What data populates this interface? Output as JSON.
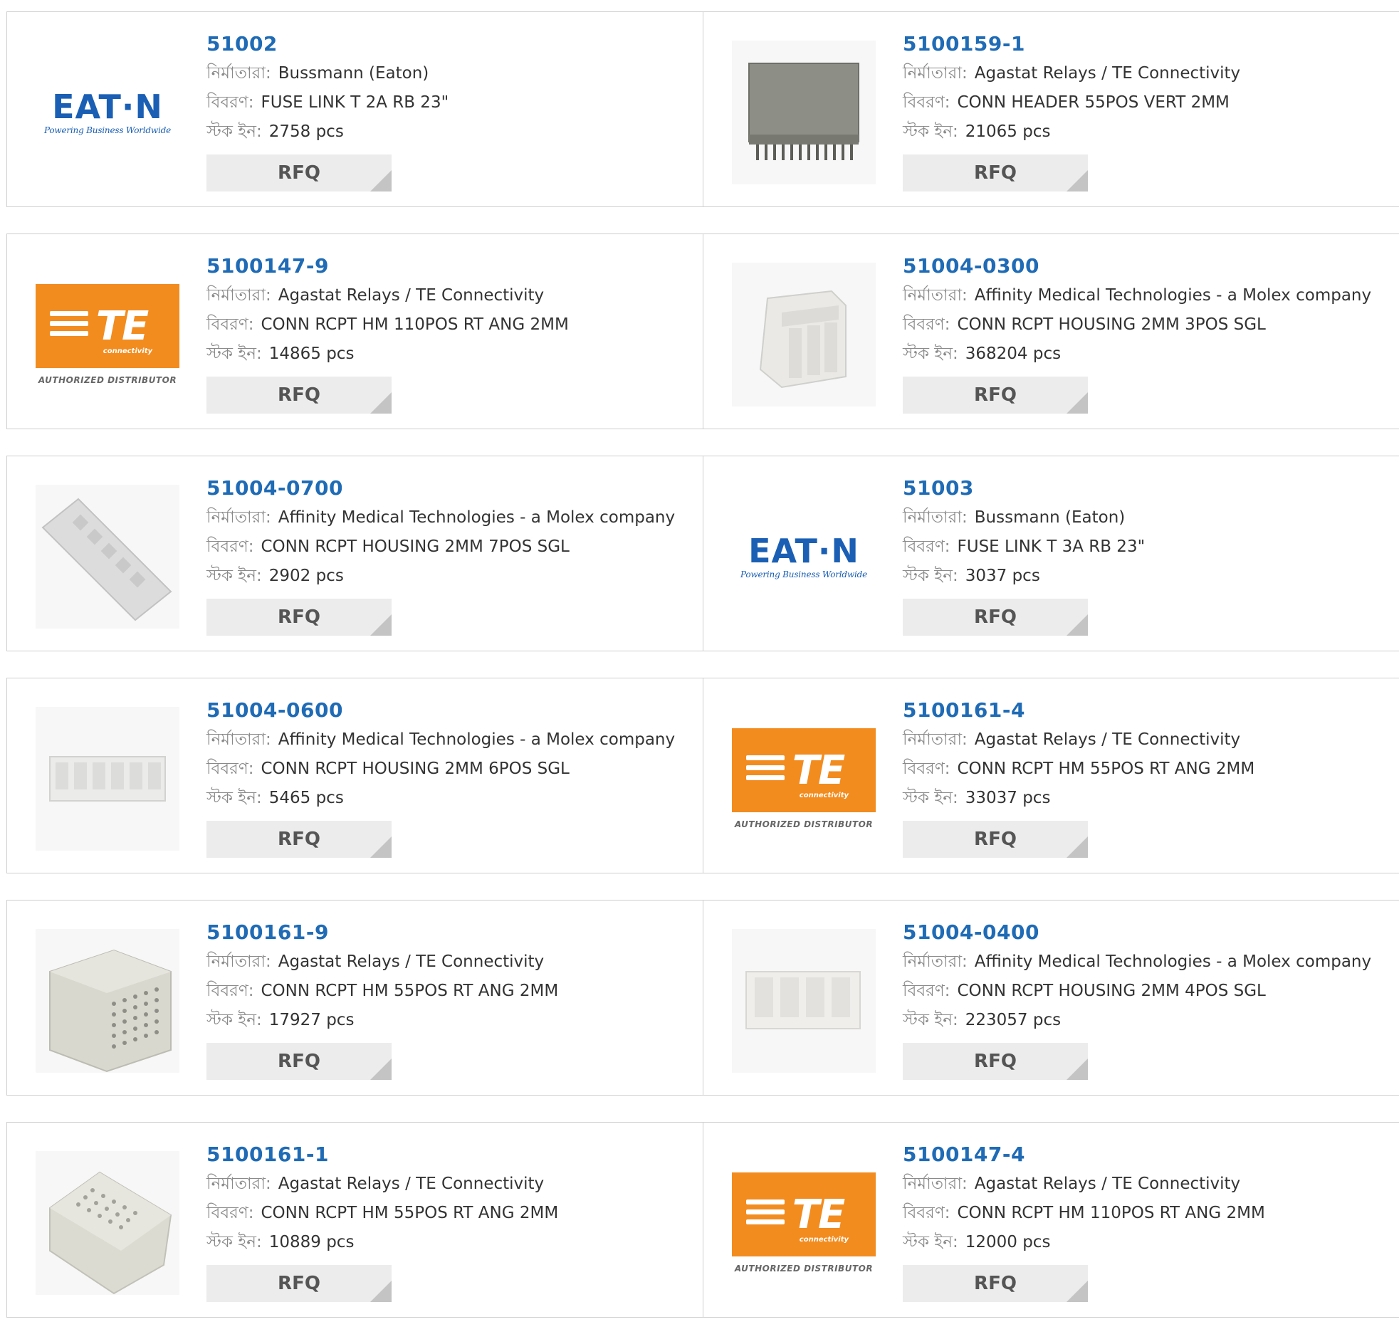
{
  "labels": {
    "manufacturer": "নির্মাতারা:",
    "description": "বিবরণ:",
    "stock": "স্টক ইন:",
    "rfq": "RFQ"
  },
  "logos": {
    "eaton_word": "EAT·N",
    "eaton_tag": "Powering Business Worldwide",
    "te_word": "TE",
    "te_sub": "connectivity",
    "te_dist": "AUTHORIZED DISTRIBUTOR"
  },
  "products": [
    {
      "part": "51002",
      "manufacturer": "Bussmann (Eaton)",
      "description": "FUSE LINK T 2A RB 23\"",
      "stock": "2758 pcs",
      "image": "eaton-logo"
    },
    {
      "part": "5100159-1",
      "manufacturer": "Agastat Relays / TE Connectivity",
      "description": "CONN HEADER 55POS VERT 2MM",
      "stock": "21065 pcs",
      "image": "header-photo"
    },
    {
      "part": "5100147-9",
      "manufacturer": "Agastat Relays / TE Connectivity",
      "description": "CONN RCPT HM 110POS RT ANG 2MM",
      "stock": "14865 pcs",
      "image": "te-logo"
    },
    {
      "part": "51004-0300",
      "manufacturer": "Affinity Medical Technologies - a Molex company",
      "description": "CONN RCPT HOUSING 2MM 3POS SGL",
      "stock": "368204 pcs",
      "image": "housing3-photo"
    },
    {
      "part": "51004-0700",
      "manufacturer": "Affinity Medical Technologies - a Molex company",
      "description": "CONN RCPT HOUSING 2MM 7POS SGL",
      "stock": "2902 pcs",
      "image": "housing7-photo"
    },
    {
      "part": "51003",
      "manufacturer": "Bussmann (Eaton)",
      "description": "FUSE LINK T 3A RB 23\"",
      "stock": "3037 pcs",
      "image": "eaton-logo"
    },
    {
      "part": "51004-0600",
      "manufacturer": "Affinity Medical Technologies - a Molex company",
      "description": "CONN RCPT HOUSING 2MM 6POS SGL",
      "stock": "5465 pcs",
      "image": "housing6-photo"
    },
    {
      "part": "5100161-4",
      "manufacturer": "Agastat Relays / TE Connectivity",
      "description": "CONN RCPT HM 55POS RT ANG 2MM",
      "stock": "33037 pcs",
      "image": "te-logo"
    },
    {
      "part": "5100161-9",
      "manufacturer": "Agastat Relays / TE Connectivity",
      "description": "CONN RCPT HM 55POS RT ANG 2MM",
      "stock": "17927 pcs",
      "image": "hm-photo"
    },
    {
      "part": "51004-0400",
      "manufacturer": "Affinity Medical Technologies - a Molex company",
      "description": "CONN RCPT HOUSING 2MM 4POS SGL",
      "stock": "223057 pcs",
      "image": "housing4-photo"
    },
    {
      "part": "5100161-1",
      "manufacturer": "Agastat Relays / TE Connectivity",
      "description": "CONN RCPT HM 55POS RT ANG 2MM",
      "stock": "10889 pcs",
      "image": "hm2-photo"
    },
    {
      "part": "5100147-4",
      "manufacturer": "Agastat Relays / TE Connectivity",
      "description": "CONN RCPT HM 110POS RT ANG 2MM",
      "stock": "12000 pcs",
      "image": "te-logo"
    }
  ],
  "colors": {
    "link": "#1f6bb5",
    "label": "#8a8a8a",
    "button_bg": "#ececec",
    "te_orange": "#f28c1f",
    "eaton_blue": "#1a5fb4"
  }
}
